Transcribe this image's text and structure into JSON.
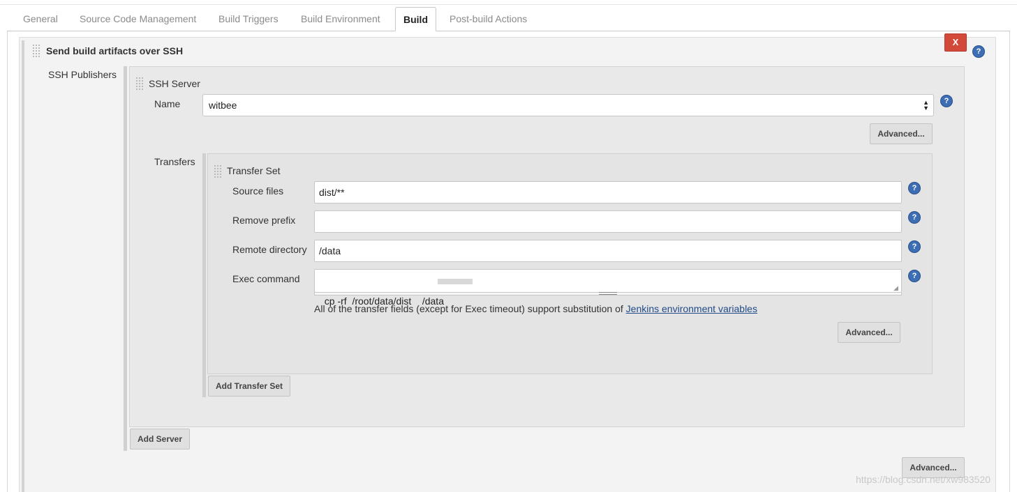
{
  "tabs": [
    {
      "label": "General",
      "active": false
    },
    {
      "label": "Source Code Management",
      "active": false
    },
    {
      "label": "Build Triggers",
      "active": false
    },
    {
      "label": "Build Environment",
      "active": false
    },
    {
      "label": "Build",
      "active": true
    },
    {
      "label": "Post-build Actions",
      "active": false
    }
  ],
  "section": {
    "title": "Send build artifacts over SSH",
    "delete_label": "X",
    "help": "?"
  },
  "ssh_publishers": {
    "label": "SSH Publishers",
    "server": {
      "title": "SSH Server",
      "name_label": "Name",
      "name_value": "witbee",
      "advanced_label": "Advanced..."
    },
    "transfers_label": "Transfers",
    "transfer_set": {
      "title": "Transfer Set",
      "source_files_label": "Source files",
      "source_files_value": "dist/**",
      "remove_prefix_label": "Remove prefix",
      "remove_prefix_value": "",
      "remote_directory_label": "Remote directory",
      "remote_directory_value": "/data",
      "exec_command_label": "Exec command",
      "exec_command_value": "cp -rf  /root/data/dist    /data",
      "note_text": "All of the transfer fields (except for Exec timeout) support substitution of ",
      "note_link": "Jenkins environment variables",
      "advanced_label": "Advanced..."
    },
    "add_transfer_set_label": "Add Transfer Set",
    "add_server_label": "Add Server",
    "advanced_label": "Advanced..."
  },
  "watermark": "https://blog.csdn.net/xw983520",
  "colors": {
    "help_icon": "#3d6eb4",
    "delete_button": "#d24939",
    "link": "#204a87"
  }
}
